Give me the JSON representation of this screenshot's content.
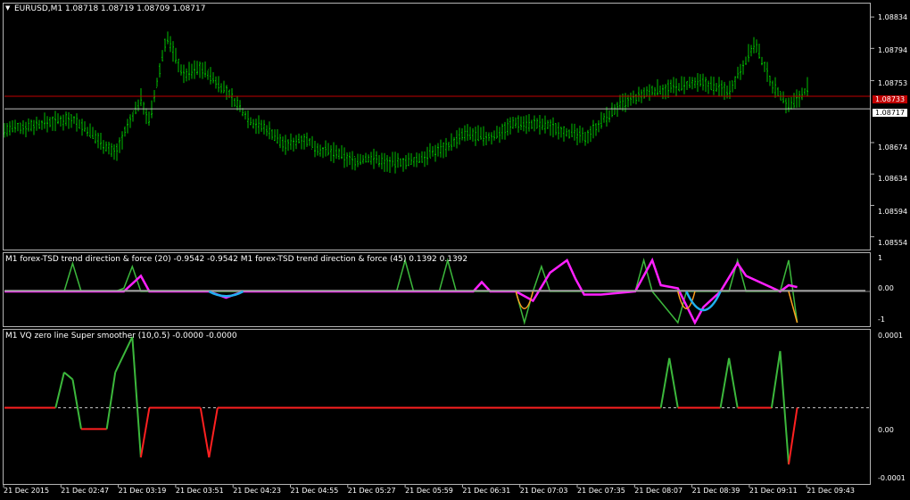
{
  "main": {
    "symbol_arrow": "▼",
    "header": "EURUSD,M1  1.08718 1.08719 1.08709 1.08717",
    "price_labels": [
      "1.08834",
      "1.08794",
      "1.08753",
      "1.08674",
      "1.08634",
      "1.08594",
      "1.08554"
    ],
    "current_price": "1.08717",
    "red_level": "1.08733",
    "colors": {
      "bars": "#00c000",
      "red_line": "#c00000",
      "bid_line": "#c0c0c0"
    }
  },
  "indicator1": {
    "header": "M1 forex-TSD trend direction & force (20) -0.9542 -0.9542  M1 forex-TSD trend direction & force (45) 0.1392 0.1392",
    "scale_labels": [
      "1",
      "0.00",
      "-1"
    ],
    "colors": {
      "up20": "#3cb83c",
      "down20": "#ffa020",
      "up45": "#ff20ff",
      "down45": "#20b0f0",
      "neutral": "#a0a0a0"
    }
  },
  "indicator2": {
    "header": "M1 VQ zero line Super smoother (10,0.5) -0.0000 -0.0000",
    "scale_labels": [
      "0.0001",
      "0.00",
      "-0.0001"
    ],
    "colors": {
      "up": "#3cb83c",
      "down": "#ff2020",
      "neutral": "#ff2020"
    }
  },
  "time_labels": [
    "21 Dec 2015",
    "21 Dec 02:47",
    "21 Dec 03:19",
    "21 Dec 03:51",
    "21 Dec 04:23",
    "21 Dec 04:55",
    "21 Dec 05:27",
    "21 Dec 05:59",
    "21 Dec 06:31",
    "21 Dec 07:03",
    "21 Dec 07:35",
    "21 Dec 08:07",
    "21 Dec 08:39",
    "21 Dec 09:11",
    "21 Dec 09:43"
  ],
  "chart_data": [
    {
      "type": "bar",
      "title": "EURUSD,M1",
      "x_ticks": [
        "21 Dec 2015",
        "21 Dec 02:47",
        "21 Dec 03:19",
        "21 Dec 03:51",
        "21 Dec 04:23",
        "21 Dec 04:55",
        "21 Dec 05:27",
        "21 Dec 05:59",
        "21 Dec 06:31",
        "21 Dec 07:03",
        "21 Dec 07:35",
        "21 Dec 08:07",
        "21 Dec 08:39",
        "21 Dec 09:11",
        "21 Dec 09:43"
      ],
      "y_ticks": [
        1.08834,
        1.08794,
        1.08753,
        1.08674,
        1.08634,
        1.08594,
        1.08554
      ],
      "ylim": [
        1.0854,
        1.0885
      ],
      "close_path_x": [
        0,
        8,
        13,
        16,
        17,
        19,
        21,
        23,
        26,
        29,
        31,
        33,
        35,
        37,
        39,
        41,
        43,
        45,
        48,
        50,
        52,
        54,
        57,
        60,
        64,
        68,
        72,
        76,
        79,
        82,
        85,
        88,
        90,
        92,
        94,
        96,
        97,
        99,
        101
      ],
      "close_path": [
        1.0869,
        1.08705,
        1.0866,
        1.0873,
        1.087,
        1.0881,
        1.0876,
        1.0877,
        1.0874,
        1.087,
        1.0869,
        1.0867,
        1.0868,
        1.08665,
        1.0866,
        1.0865,
        1.08655,
        1.08648,
        1.0865,
        1.0866,
        1.0867,
        1.08685,
        1.0868,
        1.087,
        1.08695,
        1.0868,
        1.0872,
        1.0874,
        1.08745,
        1.0875,
        1.0874,
        1.088,
        1.0875,
        1.0872,
        1.0874,
        1.0879,
        1.0876,
        1.0882,
        1.08717
      ],
      "current_price": 1.08717,
      "red_level": 1.08733
    },
    {
      "type": "line",
      "title": "forex-TSD trend direction & force",
      "ylim": [
        -1,
        1
      ],
      "series": [
        {
          "name": "(20)",
          "points": [
            [
              0,
              0
            ],
            [
              7,
              0
            ],
            [
              8,
              0.9
            ],
            [
              9,
              0
            ],
            [
              13,
              0
            ],
            [
              14,
              0.1
            ],
            [
              15,
              0.8
            ],
            [
              16,
              0
            ],
            [
              46,
              0
            ],
            [
              47,
              1
            ],
            [
              48,
              0
            ],
            [
              51,
              0
            ],
            [
              52,
              1
            ],
            [
              53,
              0
            ],
            [
              60,
              0
            ],
            [
              61,
              -1
            ],
            [
              62,
              0
            ],
            [
              63,
              0.8
            ],
            [
              64,
              0
            ],
            [
              74,
              0
            ],
            [
              75,
              1
            ],
            [
              76,
              0
            ],
            [
              79,
              -1
            ],
            [
              80,
              0
            ],
            [
              85,
              0
            ],
            [
              86,
              1
            ],
            [
              87,
              0
            ],
            [
              91,
              0
            ],
            [
              92,
              1
            ],
            [
              93,
              -1
            ]
          ]
        },
        {
          "name": "(45)",
          "points": [
            [
              0,
              0
            ],
            [
              14,
              0
            ],
            [
              16,
              0.5
            ],
            [
              17,
              0
            ],
            [
              24,
              0
            ],
            [
              26,
              -0.2
            ],
            [
              28,
              0
            ],
            [
              55,
              0
            ],
            [
              56,
              0.3
            ],
            [
              57,
              0
            ],
            [
              60,
              0
            ],
            [
              62,
              -0.3
            ],
            [
              64,
              0.6
            ],
            [
              66,
              1
            ],
            [
              67,
              0.4
            ],
            [
              68,
              -0.1
            ],
            [
              70,
              -0.1
            ],
            [
              74,
              0
            ],
            [
              76,
              1
            ],
            [
              77,
              0.2
            ],
            [
              79,
              0.1
            ],
            [
              81,
              -1
            ],
            [
              82,
              -0.5
            ],
            [
              84,
              0
            ],
            [
              86,
              0.9
            ],
            [
              87,
              0.5
            ],
            [
              91,
              0
            ],
            [
              92,
              0.2
            ],
            [
              93,
              0.14
            ]
          ]
        }
      ]
    },
    {
      "type": "line",
      "title": "VQ zero line Super smoother (10,0.5)",
      "ylim": [
        -0.0001,
        0.0001
      ],
      "series": [
        {
          "name": "VQ",
          "points": [
            [
              0,
              0
            ],
            [
              6,
              0
            ],
            [
              7,
              5e-05
            ],
            [
              8,
              4e-05
            ],
            [
              9,
              -3e-05
            ],
            [
              12,
              -3e-05
            ],
            [
              13,
              5e-05
            ],
            [
              15,
              0.0001
            ],
            [
              16,
              -7e-05
            ],
            [
              17,
              0
            ],
            [
              23,
              0
            ],
            [
              24,
              -7e-05
            ],
            [
              25,
              0
            ],
            [
              77,
              0
            ],
            [
              78,
              7e-05
            ],
            [
              79,
              0
            ],
            [
              84,
              0
            ],
            [
              85,
              7e-05
            ],
            [
              86,
              0
            ],
            [
              90,
              0
            ],
            [
              91,
              8e-05
            ],
            [
              92,
              -8e-05
            ],
            [
              93,
              0
            ]
          ]
        }
      ]
    }
  ]
}
